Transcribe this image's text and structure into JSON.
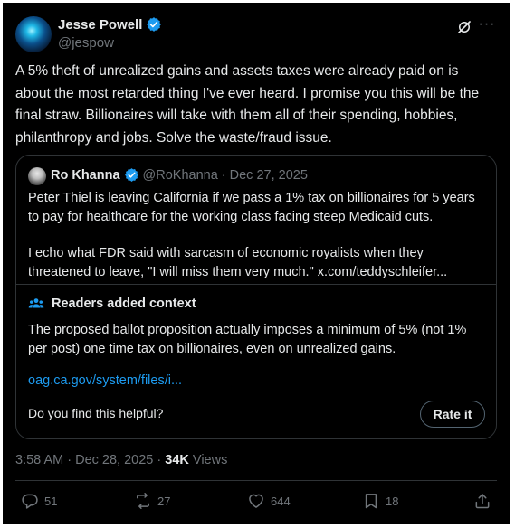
{
  "author": {
    "name": "Jesse Powell",
    "handle": "@jespow"
  },
  "tweet": {
    "text": "A 5% theft of unrealized gains and assets taxes were already paid on is about the most retarded thing I've ever heard. I promise you this will be the final straw. Billionaires will take with them all of their spending, hobbies, philanthropy and jobs. Solve the waste/fraud issue."
  },
  "quote": {
    "name": "Ro Khanna",
    "handle": "@RoKhanna",
    "separator": "·",
    "date": "Dec 27, 2025",
    "paragraph1": "Peter Thiel is leaving California if we pass a 1% tax on billionaires for 5 years to pay for healthcare for the working class facing steep Medicaid cuts.",
    "paragraph2": "I echo what FDR said with sarcasm of economic royalists when they threatened to leave, \"I will miss them very much.\" x.com/teddyschleifer..."
  },
  "community_note": {
    "title": "Readers added context",
    "text": "The proposed ballot proposition actually imposes a minimum of 5% (not 1% per post) one time tax on billionaires, even on unrealized gains.",
    "link": "oag.ca.gov/system/files/i...",
    "prompt": "Do you find this helpful?",
    "rate_label": "Rate it"
  },
  "meta": {
    "time": "3:58 AM",
    "separator1": "·",
    "date": "Dec 28, 2025",
    "separator2": "·",
    "views_count": "34K",
    "views_label": "Views"
  },
  "actions": {
    "replies": "51",
    "reposts": "27",
    "likes": "644",
    "bookmarks": "18"
  },
  "colors": {
    "background": "#000000",
    "text": "#e7e9ea",
    "muted": "#71767b",
    "link": "#1d9bf0",
    "verified": "#1d9bf0",
    "border": "#2f3336"
  },
  "icons": [
    "grok-icon",
    "more-icon",
    "verified-icon",
    "readers-icon",
    "reply-icon",
    "repost-icon",
    "like-icon",
    "bookmark-icon",
    "share-icon"
  ]
}
